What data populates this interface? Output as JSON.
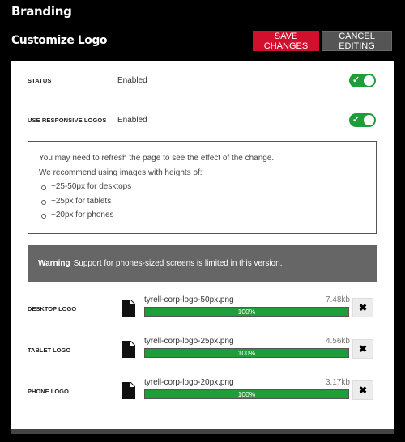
{
  "header": {
    "page_title": "Branding",
    "section_title": "Customize Logo",
    "save_label": "SAVE CHANGES",
    "cancel_label": "CANCEL EDITING"
  },
  "settings": {
    "status_label": "STATUS",
    "status_value": "Enabled",
    "status_on": true,
    "responsive_label": "USE RESPONSIVE LOGOS",
    "responsive_value": "Enabled",
    "responsive_on": true
  },
  "info": {
    "line1": "You may need to refresh the page to see the effect of the change.",
    "line2": "We recommend using images with heights of:",
    "items": [
      "~25-50px for desktops",
      "~25px for tablets",
      "~20px for phones"
    ]
  },
  "warning": {
    "title": "Warning",
    "text": "Support for phones-sized screens is limited in this version."
  },
  "logos": [
    {
      "label": "DESKTOP LOGO",
      "file": "tyrell-corp-logo-50px.png",
      "size": "7.48kb",
      "progress": "100%"
    },
    {
      "label": "TABLET LOGO",
      "file": "tyrell-corp-logo-25px.png",
      "size": "4.56kb",
      "progress": "100%"
    },
    {
      "label": "PHONE LOGO",
      "file": "tyrell-corp-logo-20px.png",
      "size": "3.17kb",
      "progress": "100%"
    }
  ],
  "icons": {
    "file": "file-icon",
    "remove": "close-icon",
    "toggle_check": "check-icon"
  },
  "colors": {
    "save_button": "#d0102c",
    "cancel_button": "#555555",
    "toggle_on": "#1e9e3a",
    "progress": "#1e9e3a",
    "warning_bg": "#666666"
  }
}
